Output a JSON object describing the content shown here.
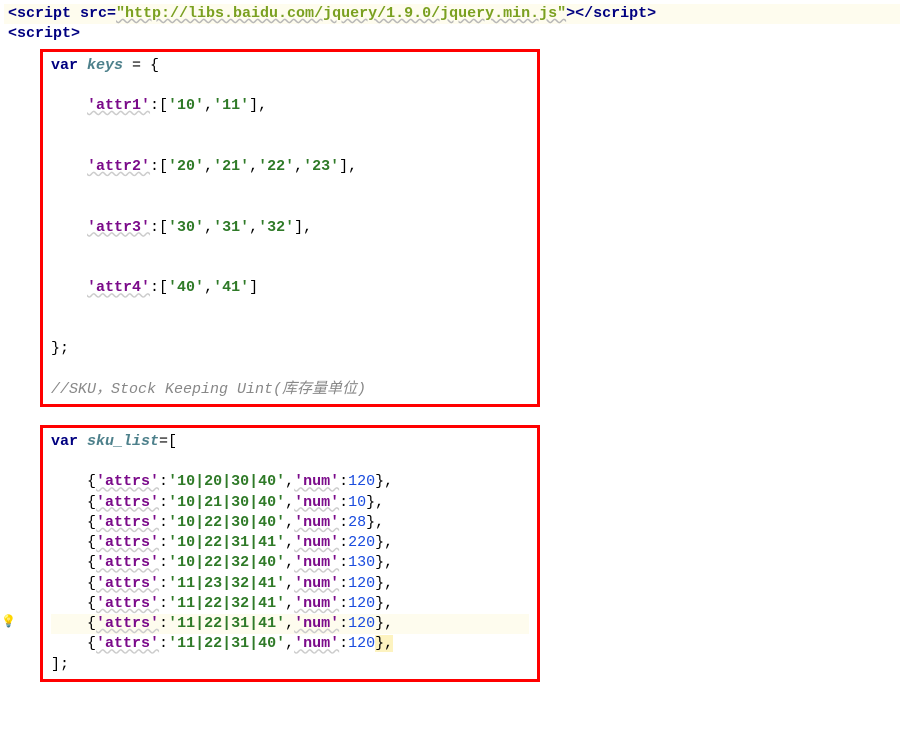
{
  "header": {
    "line1_open_script": "<script",
    "line1_attr": " src=",
    "line1_url": "\"http://libs.baidu.com/jquery/1.9.0/jquery.min.js\"",
    "line1_close1": ">",
    "line1_close2": "</script>",
    "line2": "<script>"
  },
  "block1": {
    "decl_kw": "var",
    "decl_name": " keys",
    "decl_rest": " = {",
    "attr1_key": "'attr1'",
    "attr1_rest_a": ":[",
    "attr1_v1": "'10'",
    "attr1_c1": ",",
    "attr1_v2": "'11'",
    "attr1_end": "],",
    "attr2_key": "'attr2'",
    "attr2_rest_a": ":[",
    "attr2_v1": "'20'",
    "attr2_c1": ",",
    "attr2_v2": "'21'",
    "attr2_c2": ",",
    "attr2_v3": "'22'",
    "attr2_c3": ",",
    "attr2_v4": "'23'",
    "attr2_end": "],",
    "attr3_key": "'attr3'",
    "attr3_rest_a": ":[",
    "attr3_v1": "'30'",
    "attr3_c1": ",",
    "attr3_v2": "'31'",
    "attr3_c2": ",",
    "attr3_v3": "'32'",
    "attr3_end": "],",
    "attr4_key": "'attr4'",
    "attr4_rest_a": ":[",
    "attr4_v1": "'40'",
    "attr4_c1": ",",
    "attr4_v2": "'41'",
    "attr4_end": "]",
    "close": "};",
    "comment": "//SKU，Stock Keeping Uint(库存量单位)"
  },
  "block2": {
    "decl_kw": "var",
    "decl_name": " sku_list",
    "decl_rest": "=[",
    "rows": [
      {
        "open": "{",
        "k1": "'attrs'",
        "c1": ":",
        "v1": "'10|20|30|40'",
        "cm": ",",
        "k2": "'num'",
        "c2": ":",
        "n": "120",
        "end": "},"
      },
      {
        "open": "{",
        "k1": "'attrs'",
        "c1": ":",
        "v1": "'10|21|30|40'",
        "cm": ",",
        "k2": "'num'",
        "c2": ":",
        "n": "10",
        "end": "},"
      },
      {
        "open": "{",
        "k1": "'attrs'",
        "c1": ":",
        "v1": "'10|22|30|40'",
        "cm": ",",
        "k2": "'num'",
        "c2": ":",
        "n": "28",
        "end": "},"
      },
      {
        "open": "{",
        "k1": "'attrs'",
        "c1": ":",
        "v1": "'10|22|31|41'",
        "cm": ",",
        "k2": "'num'",
        "c2": ":",
        "n": "220",
        "end": "},"
      },
      {
        "open": "{",
        "k1": "'attrs'",
        "c1": ":",
        "v1": "'10|22|32|40'",
        "cm": ",",
        "k2": "'num'",
        "c2": ":",
        "n": "130",
        "end": "},"
      },
      {
        "open": "{",
        "k1": "'attrs'",
        "c1": ":",
        "v1": "'11|23|32|41'",
        "cm": ",",
        "k2": "'num'",
        "c2": ":",
        "n": "120",
        "end": "},"
      },
      {
        "open": "{",
        "k1": "'attrs'",
        "c1": ":",
        "v1": "'11|22|32|41'",
        "cm": ",",
        "k2": "'num'",
        "c2": ":",
        "n": "120",
        "end": "},"
      },
      {
        "open": "{",
        "k1": "'attrs'",
        "c1": ":",
        "v1": "'11|22|31|41'",
        "cm": ",",
        "k2": "'num'",
        "c2": ":",
        "n": "120",
        "end": "},",
        "hl": true,
        "bulb": true
      },
      {
        "open": "{",
        "k1": "'attrs'",
        "c1": ":",
        "v1": "'11|22|31|40'",
        "cm": ",",
        "k2": "'num'",
        "c2": ":",
        "n": "120",
        "end": "},",
        "trailhl": true
      }
    ],
    "close": "];"
  }
}
